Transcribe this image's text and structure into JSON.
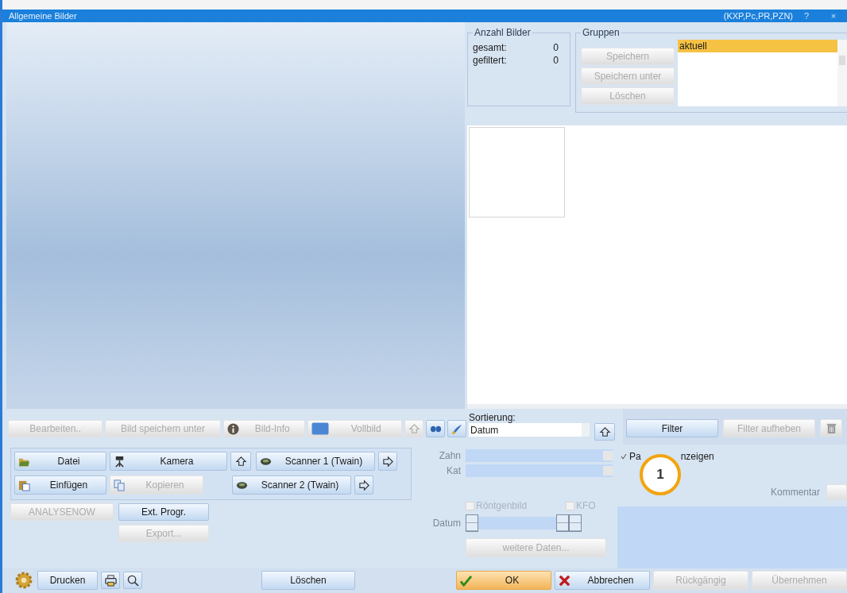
{
  "window": {
    "title": "Allgemeine Bilder",
    "context": "(KXP,Pc,PR,PZN)",
    "help": "?",
    "close": "×"
  },
  "count_box": {
    "title": "Anzahl Bilder",
    "rows": [
      {
        "label": "gesamt:",
        "value": "0"
      },
      {
        "label": "gefiltert:",
        "value": "0"
      }
    ]
  },
  "groups": {
    "title": "Gruppen",
    "buttons": [
      {
        "label": "Speichern",
        "disabled": true
      },
      {
        "label": "Speichern unter",
        "disabled": true
      },
      {
        "label": "Löschen",
        "disabled": true
      }
    ],
    "list": [
      {
        "label": "aktuell",
        "selected": true
      }
    ]
  },
  "toolbar": [
    {
      "label": "Bearbeiten..",
      "disabled": true
    },
    {
      "label": "Bild speichern unter",
      "disabled": true
    },
    {
      "label": "Bild-Info",
      "disabled": true
    },
    {
      "label": "Vollbild",
      "disabled": true
    }
  ],
  "toolbar_icons": [
    {
      "disabled": true
    },
    {
      "disabled": false
    },
    {
      "disabled": false
    }
  ],
  "devices": [
    {
      "label": "Datei",
      "disabled": false
    },
    {
      "label": "Kamera",
      "disabled": false
    },
    {
      "label": "Scanner 1 (Twain)",
      "disabled": false
    },
    {
      "label": "Einfügen",
      "disabled": false
    },
    {
      "label": "Kopieren",
      "disabled": true
    },
    {
      "label": "Scanner 2 (Twain)",
      "disabled": false
    }
  ],
  "extra_buttons": [
    {
      "label": "ANALYSENOW",
      "disabled": true
    },
    {
      "label": "Ext. Progr.",
      "disabled": false
    },
    {
      "label": "Export...",
      "disabled": true
    }
  ],
  "sorting": {
    "label": "Sortierung:",
    "value": "Datum"
  },
  "filter": [
    {
      "label": "Filter",
      "disabled": false
    },
    {
      "label": "Filter aufheben",
      "disabled": true
    }
  ],
  "fields": [
    {
      "label": "Zahn"
    },
    {
      "label": "Kat"
    }
  ],
  "show_checkbox": {
    "label_parts": [
      "Pa",
      "nzeigen"
    ],
    "checked": true
  },
  "comment": {
    "label": "Kommentar"
  },
  "checkboxes": [
    {
      "label": "Röntgenbild",
      "checked": false
    },
    {
      "label": "KFO",
      "checked": false
    }
  ],
  "date": {
    "label": "Datum"
  },
  "more_button": {
    "label": "weitere Daten...",
    "disabled": true
  },
  "callout": {
    "number": "1"
  },
  "footer_left": [
    {
      "label": "Drucken",
      "disabled": false
    },
    {
      "label": "Löschen",
      "disabled": false
    }
  ],
  "footer_right": [
    {
      "label": "OK",
      "kind": "ok",
      "disabled": false
    },
    {
      "label": "Abbrechen",
      "kind": "cancel",
      "disabled": false
    },
    {
      "label": "Rückgängig",
      "kind": "plain",
      "disabled": true
    },
    {
      "label": "Übernehmen",
      "kind": "plain",
      "disabled": true
    }
  ]
}
